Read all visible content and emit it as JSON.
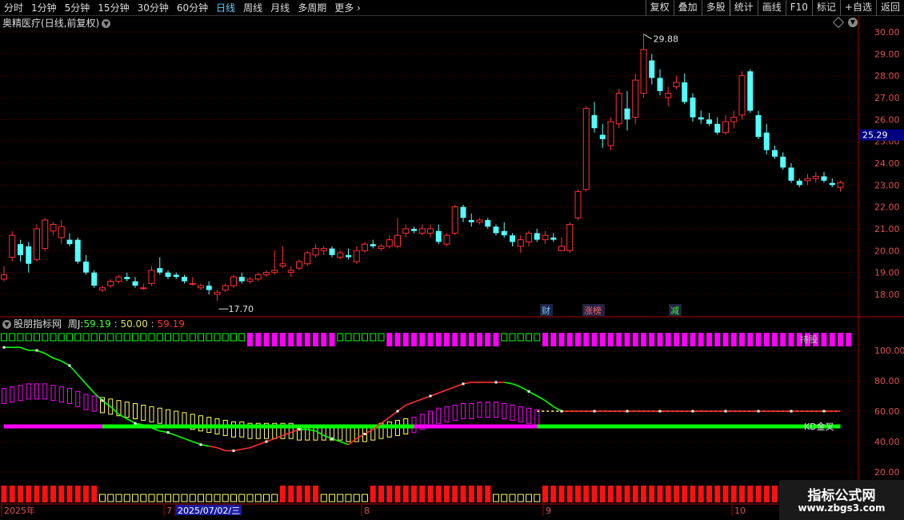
{
  "toolbar": {
    "tabs": [
      "分时",
      "1分钟",
      "5分钟",
      "15分钟",
      "30分钟",
      "60分钟",
      "日线",
      "周线",
      "月线",
      "多周期",
      "更多"
    ],
    "active_tab": "日线",
    "right_buttons": [
      "复权",
      "叠加",
      "多股",
      "统计",
      "画线",
      "F10",
      "标记",
      "+自选",
      "返回"
    ]
  },
  "stock": {
    "name": "奥精医疗",
    "period_info": "(日线,前复权)"
  },
  "indicator": {
    "name": "股朋指标网",
    "label": "周J:",
    "j_value": "59.19",
    "mid_value": "50.00",
    "last_value": "59.19",
    "kd_label": "KD金叉",
    "top_label": "持股"
  },
  "price_axis": {
    "ticks": [
      "30.00",
      "29.00",
      "28.00",
      "27.00",
      "26.00",
      "25.00",
      "24.00",
      "23.00",
      "22.00",
      "21.00",
      "20.00",
      "19.00",
      "18.00"
    ],
    "current_price": "25.29",
    "high_label": "29.88",
    "low_label": "17.70"
  },
  "ind_axis": {
    "ticks": [
      "100.00",
      "80.00",
      "60.00",
      "40.00",
      "20.00"
    ]
  },
  "date_axis": {
    "labels": [
      "2025年",
      "7",
      "2025/07/02/三",
      "8",
      "9",
      "10"
    ]
  },
  "events": [
    {
      "text": "财",
      "color": "#66ccff"
    },
    {
      "text": "涨榜",
      "color": "#ff6666"
    },
    {
      "text": "减",
      "color": "#33ff33"
    }
  ],
  "watermark": {
    "title": "指标公式网",
    "url": "www.zbgs3.com"
  },
  "colors": {
    "up": "#ff3030",
    "down": "#54ffff",
    "grid": "#7a0000",
    "axis_text": "#e05050",
    "magenta": "#ff00ff",
    "green": "#00ff00",
    "yellow": "#ffff66"
  },
  "chart_data": {
    "type": "candlestick",
    "price_ylim": [
      17.5,
      30.3
    ],
    "ohlc": [
      [
        18.7,
        19.3,
        18.6,
        18.9
      ],
      [
        19.7,
        20.9,
        19.5,
        20.7
      ],
      [
        20.3,
        20.5,
        19.5,
        19.8
      ],
      [
        20.2,
        20.4,
        19.0,
        19.4
      ],
      [
        19.6,
        21.2,
        19.5,
        21.0
      ],
      [
        20.1,
        21.5,
        20.0,
        21.4
      ],
      [
        20.9,
        21.3,
        20.7,
        21.2
      ],
      [
        20.6,
        21.4,
        20.3,
        21.1
      ],
      [
        20.5,
        20.8,
        20.2,
        20.3
      ],
      [
        20.5,
        20.6,
        19.4,
        19.5
      ],
      [
        19.5,
        19.8,
        18.9,
        19.0
      ],
      [
        19.0,
        19.1,
        18.3,
        18.4
      ],
      [
        18.2,
        18.4,
        18.1,
        18.3
      ],
      [
        18.4,
        18.7,
        18.3,
        18.6
      ],
      [
        18.6,
        18.9,
        18.5,
        18.8
      ],
      [
        18.8,
        19.0,
        18.6,
        18.7
      ],
      [
        18.6,
        18.8,
        18.3,
        18.4
      ],
      [
        18.3,
        18.5,
        18.2,
        18.3
      ],
      [
        18.5,
        19.3,
        18.4,
        19.1
      ],
      [
        19.2,
        19.7,
        18.9,
        19.0
      ],
      [
        19.0,
        19.1,
        18.7,
        18.8
      ],
      [
        18.9,
        19.0,
        18.7,
        18.8
      ],
      [
        18.8,
        18.9,
        18.5,
        18.6
      ],
      [
        18.5,
        18.8,
        18.4,
        18.5
      ],
      [
        18.3,
        18.5,
        18.2,
        18.4
      ],
      [
        18.4,
        18.6,
        18.0,
        18.2
      ],
      [
        18.0,
        18.2,
        17.7,
        18.1
      ],
      [
        18.2,
        18.5,
        18.1,
        18.4
      ],
      [
        18.4,
        18.9,
        18.3,
        18.8
      ],
      [
        18.8,
        19.0,
        18.5,
        18.6
      ],
      [
        18.6,
        18.8,
        18.5,
        18.7
      ],
      [
        18.7,
        19.0,
        18.6,
        18.9
      ],
      [
        18.9,
        19.1,
        18.8,
        19.0
      ],
      [
        19.0,
        20.0,
        18.9,
        19.1
      ],
      [
        19.3,
        20.2,
        19.2,
        19.4
      ],
      [
        19.0,
        19.3,
        18.8,
        19.1
      ],
      [
        19.2,
        19.6,
        19.1,
        19.5
      ],
      [
        19.4,
        20.0,
        19.3,
        19.9
      ],
      [
        19.8,
        20.3,
        19.7,
        20.1
      ],
      [
        20.0,
        20.2,
        19.8,
        20.1
      ],
      [
        20.1,
        20.2,
        19.7,
        19.8
      ],
      [
        19.7,
        20.0,
        19.6,
        19.9
      ],
      [
        19.8,
        20.1,
        19.6,
        19.7
      ],
      [
        19.5,
        20.2,
        19.4,
        20.0
      ],
      [
        20.0,
        20.4,
        19.9,
        20.3
      ],
      [
        20.3,
        20.5,
        20.1,
        20.2
      ],
      [
        20.1,
        20.3,
        20.0,
        20.2
      ],
      [
        20.2,
        20.7,
        20.1,
        20.5
      ],
      [
        20.2,
        21.5,
        20.1,
        20.7
      ],
      [
        20.8,
        21.2,
        20.6,
        21.0
      ],
      [
        21.0,
        21.1,
        20.8,
        20.9
      ],
      [
        20.8,
        21.2,
        20.7,
        21.0
      ],
      [
        20.8,
        21.2,
        20.6,
        21.0
      ],
      [
        20.9,
        21.2,
        20.3,
        20.4
      ],
      [
        20.3,
        20.8,
        20.2,
        20.7
      ],
      [
        20.8,
        22.1,
        20.7,
        22.0
      ],
      [
        22.0,
        22.1,
        21.3,
        21.5
      ],
      [
        21.4,
        21.7,
        21.1,
        21.3
      ],
      [
        21.3,
        21.5,
        21.2,
        21.4
      ],
      [
        21.4,
        21.5,
        21.0,
        21.1
      ],
      [
        21.1,
        21.2,
        20.7,
        20.8
      ],
      [
        20.9,
        21.3,
        20.6,
        20.7
      ],
      [
        20.7,
        20.8,
        20.2,
        20.4
      ],
      [
        20.2,
        20.7,
        19.9,
        20.5
      ],
      [
        20.4,
        20.9,
        20.2,
        20.8
      ],
      [
        20.8,
        21.0,
        20.4,
        20.5
      ],
      [
        20.5,
        20.9,
        20.3,
        20.7
      ],
      [
        20.6,
        20.8,
        20.4,
        20.5
      ],
      [
        20.0,
        20.6,
        20.0,
        20.2
      ],
      [
        20.0,
        21.3,
        19.9,
        21.2
      ],
      [
        21.5,
        22.8,
        21.4,
        22.7
      ],
      [
        22.8,
        26.6,
        22.7,
        26.5
      ],
      [
        26.2,
        26.8,
        25.4,
        25.6
      ],
      [
        25.3,
        25.8,
        24.7,
        25.1
      ],
      [
        24.8,
        26.1,
        24.6,
        25.9
      ],
      [
        25.8,
        27.4,
        25.6,
        27.2
      ],
      [
        26.5,
        27.3,
        25.5,
        26.0
      ],
      [
        26.1,
        28.1,
        25.8,
        27.8
      ],
      [
        27.2,
        29.9,
        27.0,
        29.2
      ],
      [
        28.7,
        29.0,
        27.6,
        27.9
      ],
      [
        27.9,
        28.3,
        27.1,
        27.3
      ],
      [
        27.0,
        27.5,
        26.6,
        27.2
      ],
      [
        27.5,
        28.0,
        27.4,
        27.7
      ],
      [
        27.7,
        28.1,
        26.7,
        26.8
      ],
      [
        27.0,
        27.2,
        25.9,
        26.1
      ],
      [
        26.1,
        26.4,
        25.8,
        26.0
      ],
      [
        26.0,
        26.3,
        25.7,
        25.8
      ],
      [
        25.8,
        26.1,
        25.3,
        25.4
      ],
      [
        25.4,
        26.2,
        25.3,
        25.9
      ],
      [
        25.9,
        26.4,
        25.6,
        26.1
      ],
      [
        26.2,
        28.2,
        26.0,
        28.0
      ],
      [
        28.2,
        28.3,
        26.3,
        26.4
      ],
      [
        26.2,
        26.4,
        25.1,
        25.2
      ],
      [
        25.4,
        25.8,
        24.4,
        24.6
      ],
      [
        24.6,
        24.8,
        24.2,
        24.3
      ],
      [
        24.3,
        24.5,
        23.7,
        23.8
      ],
      [
        23.8,
        24.0,
        23.1,
        23.2
      ],
      [
        23.2,
        23.3,
        22.9,
        23.0
      ],
      [
        23.2,
        23.5,
        23.0,
        23.3
      ],
      [
        23.3,
        23.6,
        23.1,
        23.4
      ],
      [
        23.4,
        23.6,
        23.1,
        23.2
      ],
      [
        23.1,
        23.3,
        22.9,
        23.0
      ],
      [
        22.9,
        23.2,
        22.7,
        23.1
      ]
    ],
    "indicator_ylim": [
      0,
      120
    ],
    "j_line": [
      102,
      102,
      102,
      100,
      100,
      98,
      95,
      93,
      90,
      84,
      78,
      72,
      67,
      63,
      58,
      55,
      52,
      51,
      49,
      47,
      46,
      44,
      42,
      40,
      38,
      37,
      36,
      34,
      34,
      35,
      36,
      38,
      40,
      42,
      44,
      46,
      48,
      48,
      47,
      44,
      42,
      40,
      38,
      42,
      45,
      48,
      52,
      56,
      60,
      64,
      66,
      68,
      70,
      72,
      74,
      76,
      78,
      79,
      79,
      79,
      79,
      79,
      78,
      76,
      73,
      70,
      67,
      63,
      60,
      60,
      60,
      60,
      60,
      60,
      60,
      60,
      60,
      60,
      60,
      60,
      60,
      60,
      60,
      60,
      60,
      60,
      60,
      60,
      60,
      60,
      60,
      60,
      60,
      60,
      60,
      60,
      60,
      60,
      60,
      60,
      60,
      60,
      60,
      60
    ],
    "j_up": [
      false,
      false,
      false,
      false,
      false,
      false,
      false,
      false,
      false,
      false,
      false,
      false,
      false,
      false,
      false,
      false,
      false,
      false,
      false,
      false,
      false,
      false,
      false,
      false,
      false,
      false,
      true,
      true,
      true,
      true,
      true,
      true,
      true,
      true,
      true,
      true,
      true,
      false,
      false,
      false,
      false,
      false,
      false,
      true,
      true,
      true,
      true,
      true,
      true,
      true,
      true,
      true,
      true,
      true,
      true,
      true,
      true,
      true,
      true,
      true,
      true,
      true,
      false,
      false,
      false,
      false,
      false,
      false,
      false,
      true,
      true,
      true,
      true,
      true,
      true,
      true,
      true,
      true,
      true,
      true,
      true,
      true,
      true,
      true,
      true,
      true,
      true,
      true,
      true,
      true,
      true,
      true,
      true,
      true,
      true,
      true,
      true,
      true,
      true,
      true,
      true,
      true,
      true,
      true
    ],
    "hist": [
      75,
      76,
      77,
      78,
      78,
      78,
      77,
      76,
      75,
      73,
      71,
      70,
      69,
      68,
      67,
      66,
      65,
      64,
      63,
      62,
      61,
      60,
      59,
      58,
      57,
      56,
      55,
      54,
      53,
      53,
      52,
      52,
      52,
      52,
      52,
      52,
      51,
      51,
      51,
      51,
      51,
      51,
      50,
      50,
      50,
      51,
      52,
      53,
      54,
      55,
      56,
      58,
      60,
      62,
      63,
      64,
      65,
      65,
      66,
      66,
      66,
      65,
      64,
      63,
      62,
      61,
      60,
      60,
      60,
      60,
      60,
      60,
      60,
      60,
      60,
      60,
      60,
      60,
      60,
      60,
      60,
      60,
      60,
      60,
      60,
      60,
      60,
      60,
      60,
      60,
      60,
      60,
      60,
      60,
      60,
      60,
      60,
      60,
      60,
      60,
      60,
      60,
      60,
      60
    ]
  }
}
